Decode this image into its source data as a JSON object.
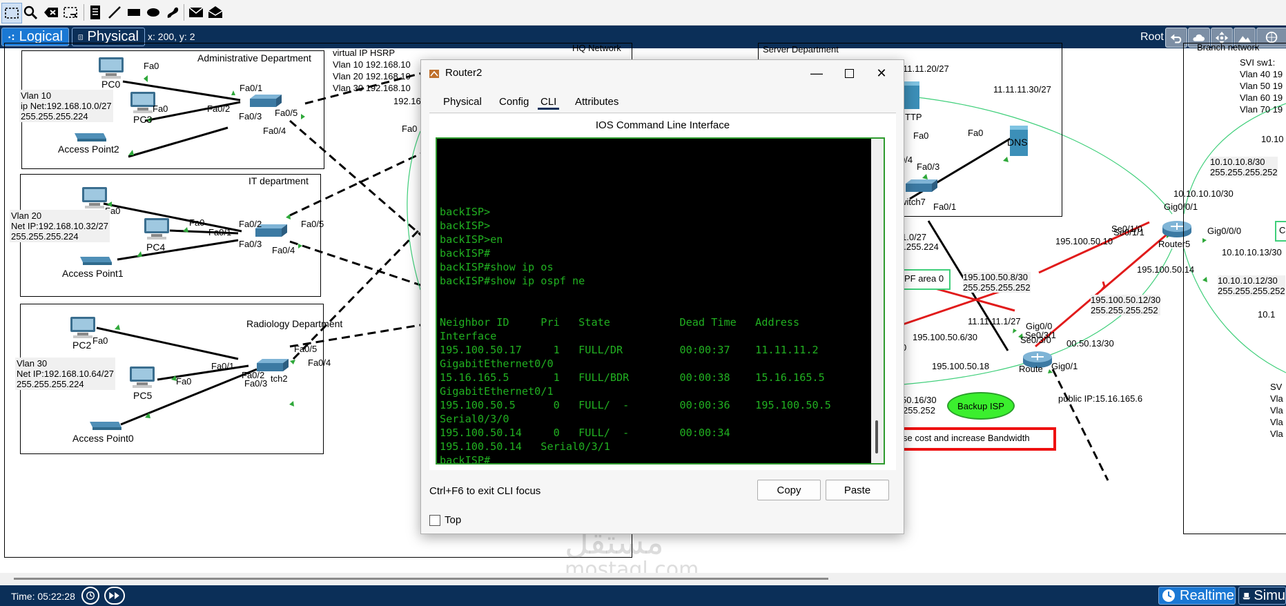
{
  "toolbar": {
    "icons": [
      "select-icon",
      "search-icon",
      "delete-icon",
      "resize-icon",
      "note-icon",
      "pen-icon",
      "rectangle-icon",
      "ellipse-icon",
      "freeform-icon",
      "mail-closed-icon",
      "mail-open-icon"
    ]
  },
  "modebar": {
    "logical_label": "Logical",
    "physical_label": "Physical",
    "coords": "x: 200, y: 2",
    "root_label": "Root"
  },
  "topology": {
    "admin_dept": {
      "title": "Administrative Department",
      "vlan": "Vlan 10",
      "net": "ip Net:192.168.10.0/27",
      "mask": "255.255.255.224",
      "pc0": "PC0",
      "pc3": "PC3",
      "ap": "Access Point2",
      "fa0_a": "Fa0",
      "fa0_b": "Fa0",
      "fa01": "Fa0/1",
      "fa02": "Fa0/2",
      "fa03": "Fa0/3",
      "fa04": "Fa0/4",
      "fa05": "Fa0/5"
    },
    "it_dept": {
      "title": "IT department",
      "vlan": "Vlan 20",
      "net": "Net IP:192.168.10.32/27",
      "mask": "255.255.255.224",
      "pc4": "PC4",
      "ap": "Access Point1",
      "fa0_a": "Fa0",
      "fa0_b": "Fa0",
      "fa01": "Fa0/1",
      "fa02": "Fa0/2",
      "fa03": "Fa0/3",
      "fa04": "Fa0/4",
      "fa05": "Fa0/5"
    },
    "radiology_dept": {
      "title": "Radiology Department",
      "vlan": "Vlan 30",
      "net": "Net IP:192.168.10.64/27",
      "mask": "255.255.255.224",
      "pc2": "PC2",
      "pc5": "PC5",
      "ap": "Access Point0",
      "switch": "tch2",
      "fa0_a": "Fa0",
      "fa0_b": "Fa0",
      "fa01": "Fa0/1",
      "fa02": "Fa0/2",
      "fa03": "Fa0/3",
      "fa04": "Fa0/4",
      "fa05": "Fa0/5"
    },
    "hsrp": {
      "title": "virtual IP HSRP",
      "l1": "Vlan 10  192.168.10",
      "l2": "Vlan 20  192.168.10",
      "l3": "Vlan 30  192.168.10",
      "partial_ip": "192.16",
      "partial_fa": "Fa0"
    },
    "hq_network": "HQ   Network",
    "server_dept": "Server Department",
    "server_ip1": "11.11.20/27",
    "server_ip2": "11.11.11.30/27",
    "tftp": "TTP",
    "dns": "DNS",
    "srv_fa0_a": "Fa0",
    "srv_fa0_b": "Fa0",
    "srv_fa04": "0/4",
    "srv_fa03": "Fa0/3",
    "switch7": "witch7",
    "srv_fa01": "Fa0/1",
    "net_partial1": "1.0/27",
    "net_partial2": "5.255.224",
    "ospf_area": "PF area 0",
    "link1_ip": "195.100.50.8/30",
    "link1_mask": "255.255.255.252",
    "r_ip1": "11.11.11.1/27",
    "r_gig00": "Gig0/0",
    "r_se031": "Se0/3/1",
    "r_se030": "Se0/3/0",
    "r_ip2": "195.100.50.6/30",
    "r_ip3": "00.50.13/30",
    "r_ip4": "195.100.50.18",
    "router_name": "Route",
    "r_gig01": "Gig0/1",
    "r_zero": "0",
    "r_ip5": "50.16/30",
    "r_mask5": "255.252",
    "backup_isp": "Backup ISP",
    "public_ip": "public IP:15.16.165.6",
    "banner_text": "se cost and increase Bandwidth",
    "r5_ip10": "195.100.50.10",
    "r5_se011": "Se0/1/1",
    "r5_se0": "Se0/1/0",
    "router5": "Router5",
    "r5_gig001": "Gig0/0/1",
    "r5_gig000": "Gig0/0/0",
    "r5_ip14": "195.100.50.14",
    "r5_ip12": "195.100.50.12/30",
    "r5_mask12": "255.255.255.252",
    "r5_101010": "10.10.10.10/30",
    "r5_1013": "10.10.10.13/30",
    "r5_108": "10.10.10.8/30",
    "r5_108mask": "255.255.255.252",
    "r5_1012": "10.10.10.12/30",
    "r5_1012mask": "255.255.255.252",
    "r5_partial1": "10.10",
    "r5_partial2": "10.1",
    "r5_partial3": "C",
    "branch": "Branch network",
    "svi_title": "SVI sw1:",
    "svi_l1": "Vlan 40  19",
    "svi_l2": "Vlan 50  19",
    "svi_l3": "Vlan 60  19",
    "svi_l4": "Vlan 70  19",
    "svi2_title": "SV",
    "svi2_l1": "Vla",
    "svi2_l2": "Vla",
    "svi2_l3": "Vla",
    "svi2_l4": "Vla"
  },
  "dialog": {
    "title": "Router2",
    "tabs": [
      "Physical",
      "Config",
      "CLI",
      "Attributes"
    ],
    "active_tab": "CLI",
    "caption": "IOS Command Line Interface",
    "terminal_lines": [
      "backISP>",
      "backISP>",
      "backISP>en",
      "backISP#",
      "backISP#show ip os",
      "backISP#show ip ospf ne",
      "",
      "",
      "Neighbor ID     Pri   State           Dead Time   Address",
      "Interface",
      "195.100.50.17     1   FULL/DR         00:00:37    11.11.11.2",
      "GigabitEthernet0/0",
      "15.16.165.5       1   FULL/BDR        00:00:38    15.16.165.5",
      "GigabitEthernet0/1",
      "195.100.50.5      0   FULL/  -        00:00:36    195.100.50.5",
      "Serial0/3/0",
      "195.100.50.14     0   FULL/  -        00:00:34",
      "195.100.50.14   Serial0/3/1",
      "backISP#"
    ],
    "exit_hint": "Ctrl+F6 to exit CLI focus",
    "copy_label": "Copy",
    "paste_label": "Paste",
    "top_label": "Top"
  },
  "watermark": {
    "arabic": "مستقل",
    "latin": "mostaql.com"
  },
  "statusbar": {
    "time": "Time: 05:22:28",
    "realtime_label": "Realtime",
    "simulation_label": "Simu"
  },
  "colors": {
    "navy": "#0b2f58",
    "terminal_green": "#21b021",
    "link_red": "#e11b1b",
    "ospf_green": "#3fcf7a",
    "backup_isp_fill": "#3bef2e"
  }
}
